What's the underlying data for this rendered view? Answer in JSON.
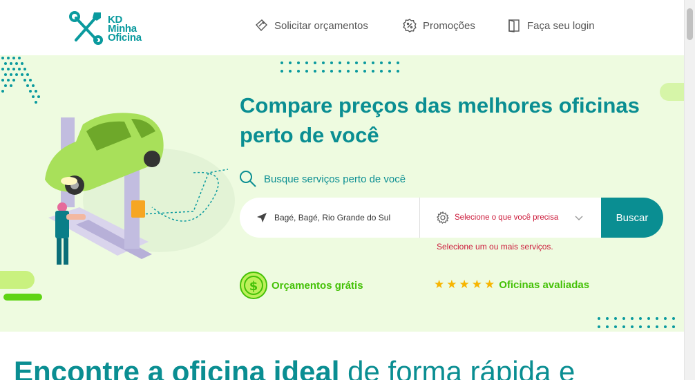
{
  "header": {
    "logo_lines": [
      "KD",
      "Minha",
      "Oficina"
    ],
    "nav": [
      {
        "label": "Solicitar orçamentos",
        "icon": "ticket-icon"
      },
      {
        "label": "Promoções",
        "icon": "percent-badge-icon"
      },
      {
        "label": "Faça seu login",
        "icon": "door-login-icon"
      }
    ]
  },
  "hero": {
    "title": "Compare preços das melhores oficinas perto de você",
    "search_label": "Busque serviços perto de você",
    "location_value": "Bagé, Bagé, Rio Grande do Sul",
    "service_placeholder": "Selecione o que você precisa",
    "search_button": "Buscar",
    "error_message": "Selecione um ou mais serviços.",
    "features": [
      {
        "label": "Orçamentos grátis",
        "icon": "dollar-coin-icon"
      },
      {
        "label": "Oficinas avaliadas",
        "icon": "stars-icon",
        "stars": "★★★★★"
      }
    ]
  },
  "bottom": {
    "heading_bold": "Encontre a oficina ideal",
    "heading_light": "de forma rápida e"
  },
  "colors": {
    "primary": "#0a8e92",
    "accent_green": "#44c107",
    "hero_bg": "#eefbe0",
    "error": "#cc1a3a",
    "star": "#f7b500"
  }
}
